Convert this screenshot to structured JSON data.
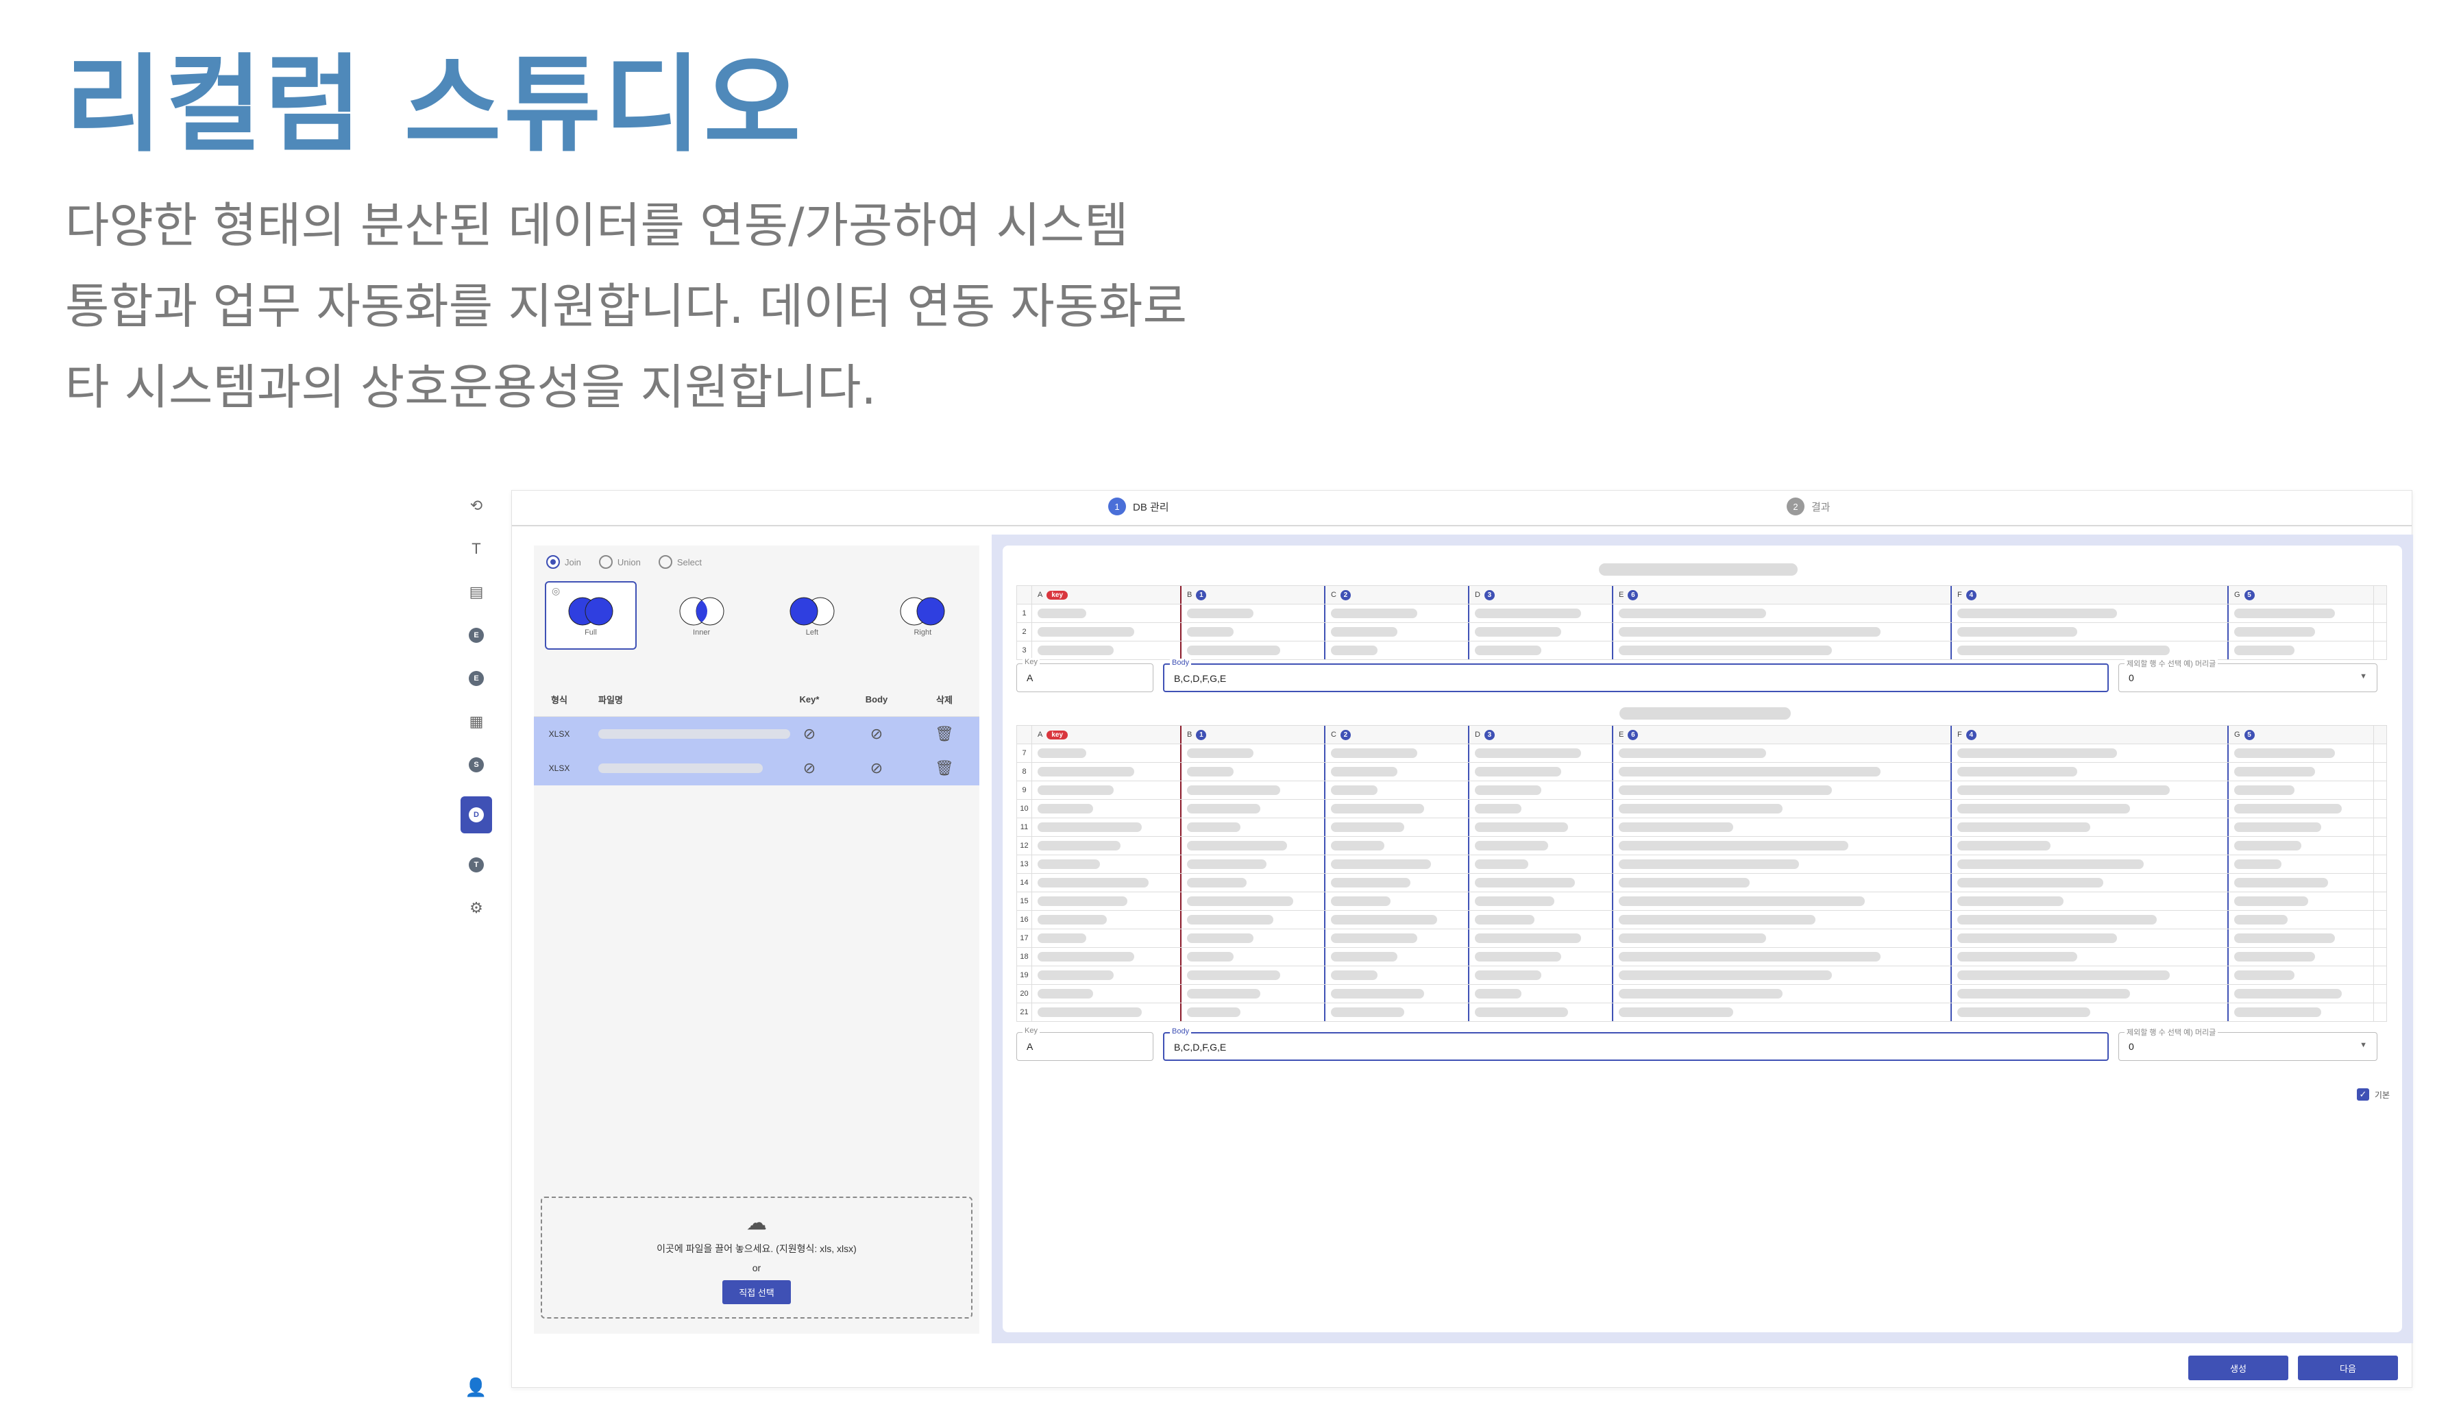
{
  "hero": {
    "title": "리컬럼 스튜디오",
    "desc_lines": [
      "다양한 형태의 분산된 데이터를 연동/가공하여 시스템",
      "통합과 업무 자동화를 지원합니다. 데이터 연동 자동화로",
      "타 시스템과의 상호운용성을 지원합니다."
    ]
  },
  "rail": {
    "items": [
      {
        "name": "refresh-icon",
        "glyph": "⟲"
      },
      {
        "name": "text-icon",
        "glyph": "T"
      },
      {
        "name": "file-settings-icon",
        "glyph": "▤"
      },
      {
        "name": "step-e-icon",
        "glyph": "E"
      },
      {
        "name": "step-e2-icon",
        "glyph": "E"
      },
      {
        "name": "dashboard-icon",
        "glyph": "▦"
      },
      {
        "name": "step-s-icon",
        "glyph": "S"
      },
      {
        "name": "step-d-icon",
        "glyph": "D"
      },
      {
        "name": "step-t-icon",
        "glyph": "T"
      },
      {
        "name": "gear-icon",
        "glyph": "⚙"
      }
    ],
    "user_glyph": "👤"
  },
  "steps": [
    {
      "num": "1",
      "label": "DB 관리"
    },
    {
      "num": "2",
      "label": "결과"
    }
  ],
  "left": {
    "radios": [
      "Join",
      "Union",
      "Select"
    ],
    "venns": [
      "Full",
      "Inner",
      "Left",
      "Right"
    ],
    "table_headers": [
      "형식",
      "파일명",
      "Key*",
      "Body",
      "삭제"
    ],
    "files": [
      {
        "type": "XLSX"
      },
      {
        "type": "XLSX"
      }
    ],
    "drop_text": "이곳에 파일을 끌어 놓으세요. (지원형식: xls, xlsx)",
    "drop_or": "or",
    "drop_button": "직접 선택"
  },
  "grid1": {
    "columns": [
      {
        "letter": "A",
        "badge": "key"
      },
      {
        "letter": "B",
        "num": "1"
      },
      {
        "letter": "C",
        "num": "2"
      },
      {
        "letter": "D",
        "num": "3"
      },
      {
        "letter": "E",
        "num": "6"
      },
      {
        "letter": "F",
        "num": "4"
      },
      {
        "letter": "G",
        "num": "5"
      }
    ],
    "rows": [
      "1",
      "2",
      "3"
    ]
  },
  "grid2": {
    "columns": [
      {
        "letter": "A",
        "badge": "key"
      },
      {
        "letter": "B",
        "num": "1"
      },
      {
        "letter": "C",
        "num": "2"
      },
      {
        "letter": "D",
        "num": "3"
      },
      {
        "letter": "E",
        "num": "6"
      },
      {
        "letter": "F",
        "num": "4"
      },
      {
        "letter": "G",
        "num": "5"
      }
    ],
    "rows": [
      "7",
      "8",
      "9",
      "10",
      "11",
      "12",
      "13",
      "14",
      "15",
      "16",
      "17",
      "18",
      "19",
      "20",
      "21"
    ]
  },
  "fields1": {
    "key_label": "Key",
    "key_value": "A",
    "body_label": "Body",
    "body_value": "B,C,D,F,G,E",
    "skip_label": "제외할 행 수 선택 예) 머리글",
    "skip_value": "0"
  },
  "fields2": {
    "key_label": "Key",
    "key_value": "A",
    "body_label": "Body",
    "body_value": "B,C,D,F,G,E",
    "skip_label": "제외할 행 수 선택 예) 머리글",
    "skip_value": "0"
  },
  "basic_label": "기본",
  "buttons": {
    "create": "생성",
    "next": "다음"
  },
  "colors": {
    "accent": "#3f51b5",
    "hero_title": "#4f89ba",
    "key_badge": "#d9363e"
  }
}
